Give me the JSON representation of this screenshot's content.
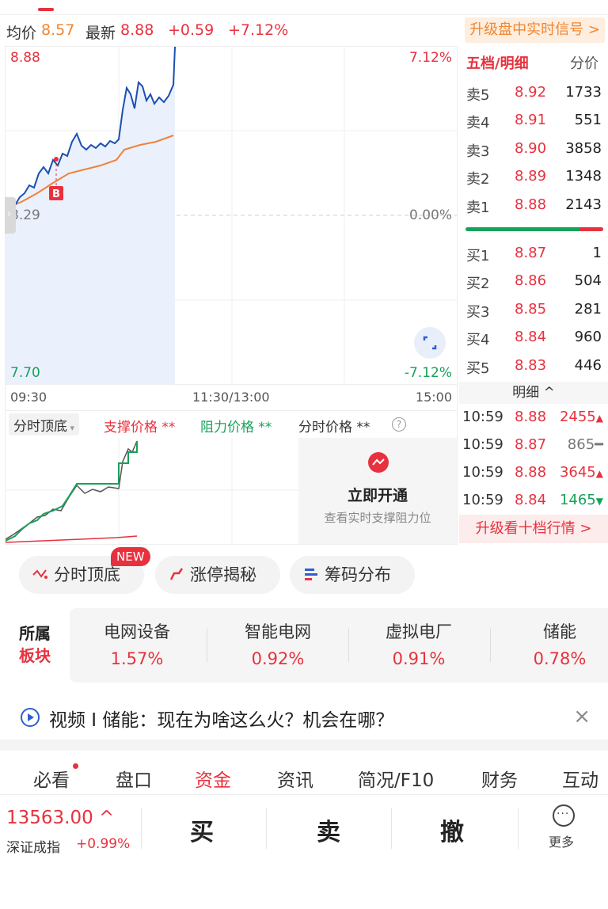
{
  "quote_bar": {
    "avg_label": "均价",
    "avg_value": "8.57",
    "latest_label": "最新",
    "latest_value": "8.88",
    "change": "+0.59",
    "change_pct": "+7.12%",
    "upgrade_signal": "升级盘中实时信号 >"
  },
  "chart": {
    "y_top": "8.88",
    "y_mid": "8.29",
    "y_bottom": "7.70",
    "pct_top": "7.12%",
    "pct_mid": "0.00%",
    "pct_bottom": "-7.12%",
    "marker": "B",
    "time_start": "09:30",
    "time_mid": "11:30/13:00",
    "time_end": "15:00",
    "colors": {
      "price_line": "#1c4fb0",
      "avg_line": "#f2803a",
      "fill": "#eaf1fc",
      "up": "#e8313e",
      "down": "#17a25a"
    }
  },
  "order_book": {
    "title": "五档/明细",
    "alt_tab": "分价",
    "sells": [
      {
        "label": "卖5",
        "price": "8.92",
        "vol": "1733"
      },
      {
        "label": "卖4",
        "price": "8.91",
        "vol": "551"
      },
      {
        "label": "卖3",
        "price": "8.90",
        "vol": "3858"
      },
      {
        "label": "卖2",
        "price": "8.89",
        "vol": "1348"
      },
      {
        "label": "卖1",
        "price": "8.88",
        "vol": "2143"
      }
    ],
    "buys": [
      {
        "label": "买1",
        "price": "8.87",
        "vol": "1"
      },
      {
        "label": "买2",
        "price": "8.86",
        "vol": "504"
      },
      {
        "label": "买3",
        "price": "8.85",
        "vol": "281"
      },
      {
        "label": "买4",
        "price": "8.84",
        "vol": "960"
      },
      {
        "label": "买5",
        "price": "8.83",
        "vol": "446"
      }
    ]
  },
  "ticks": {
    "header": "明细 ^",
    "rows": [
      {
        "time": "10:59",
        "price": "8.88",
        "vol": "2455",
        "dir": "up"
      },
      {
        "time": "10:59",
        "price": "8.87",
        "vol": "865",
        "dir": "flat"
      },
      {
        "time": "10:59",
        "price": "8.88",
        "vol": "3645",
        "dir": "up"
      },
      {
        "time": "10:59",
        "price": "8.84",
        "vol": "1465",
        "dir": "down"
      }
    ],
    "upgrade": "升级看十档行情 >"
  },
  "indicator": {
    "selector": "分时顶底",
    "support": "支撑价格 **",
    "resistance": "阻力价格 **",
    "intraday": "分时价格 **",
    "unlock_title": "立即开通",
    "unlock_sub": "查看实时支撑阻力位"
  },
  "tools": {
    "new_badge": "NEW",
    "items": [
      "分时顶底",
      "涨停揭秘",
      "筹码分布"
    ]
  },
  "sectors": {
    "label_line1": "所属",
    "label_line2": "板块",
    "items": [
      {
        "name": "电网设备",
        "pct": "1.57%"
      },
      {
        "name": "智能电网",
        "pct": "0.92%"
      },
      {
        "name": "虚拟电厂",
        "pct": "0.91%"
      },
      {
        "name": "储能",
        "pct": "0.78%"
      }
    ]
  },
  "news": {
    "text": "视频 I 储能：现在为啥这么火？机会在哪？"
  },
  "tabs": [
    "必看",
    "盘口",
    "资金",
    "资讯",
    "简况/F10",
    "财务",
    "互动"
  ],
  "active_tab": "资金",
  "bottom": {
    "index_value": "13563.00 ^",
    "index_name": "深证成指",
    "index_change": "+0.99%",
    "buy": "买",
    "sell": "卖",
    "cancel": "撤",
    "more": "更多"
  }
}
